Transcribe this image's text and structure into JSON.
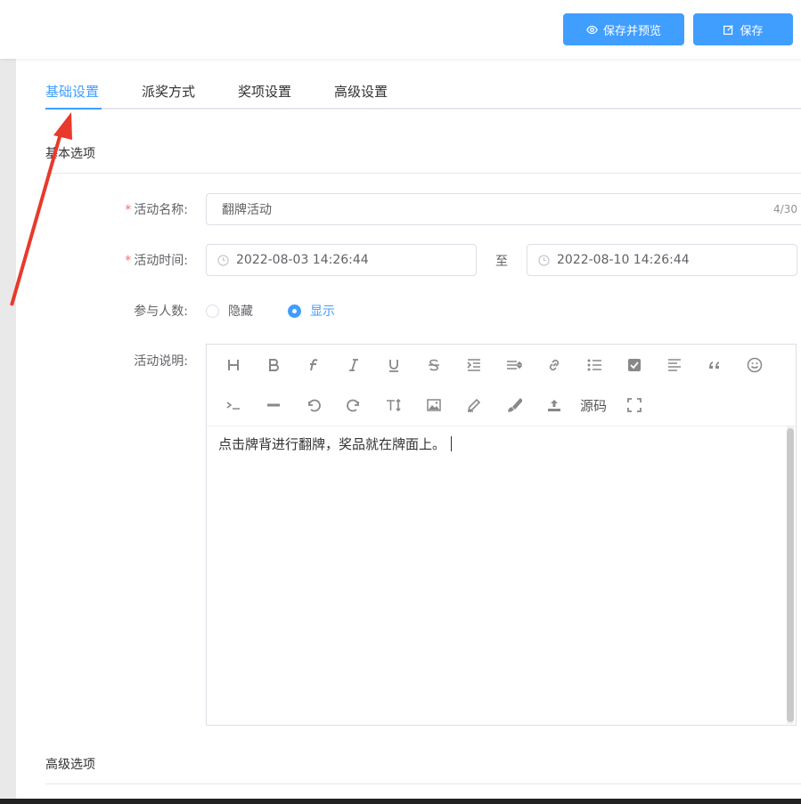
{
  "toolbar": {
    "preview_label": "保存并预览",
    "save_label": "保存"
  },
  "tabs": [
    {
      "label": "基础设置",
      "active": true
    },
    {
      "label": "派奖方式",
      "active": false
    },
    {
      "label": "奖项设置",
      "active": false
    },
    {
      "label": "高级设置",
      "active": false
    }
  ],
  "basic_section": {
    "title": "基本选项"
  },
  "advanced_section": {
    "title": "高级选项"
  },
  "form": {
    "name": {
      "label": "活动名称:",
      "value": "翻牌活动",
      "count": "4/30",
      "required": true
    },
    "time": {
      "label": "活动时间:",
      "start": "2022-08-03 14:26:44",
      "separator": "至",
      "end": "2022-08-10 14:26:44",
      "required": true
    },
    "participants": {
      "label": "参与人数:",
      "options": [
        "隐藏",
        "显示"
      ],
      "selected": "显示"
    },
    "description": {
      "label": "活动说明:",
      "content": "点击牌背进行翻牌，奖品就在牌面上。",
      "source_label": "源码"
    }
  },
  "colors": {
    "accent": "#409eff",
    "required": "#f56c6c",
    "annotation": "#e8392c"
  }
}
